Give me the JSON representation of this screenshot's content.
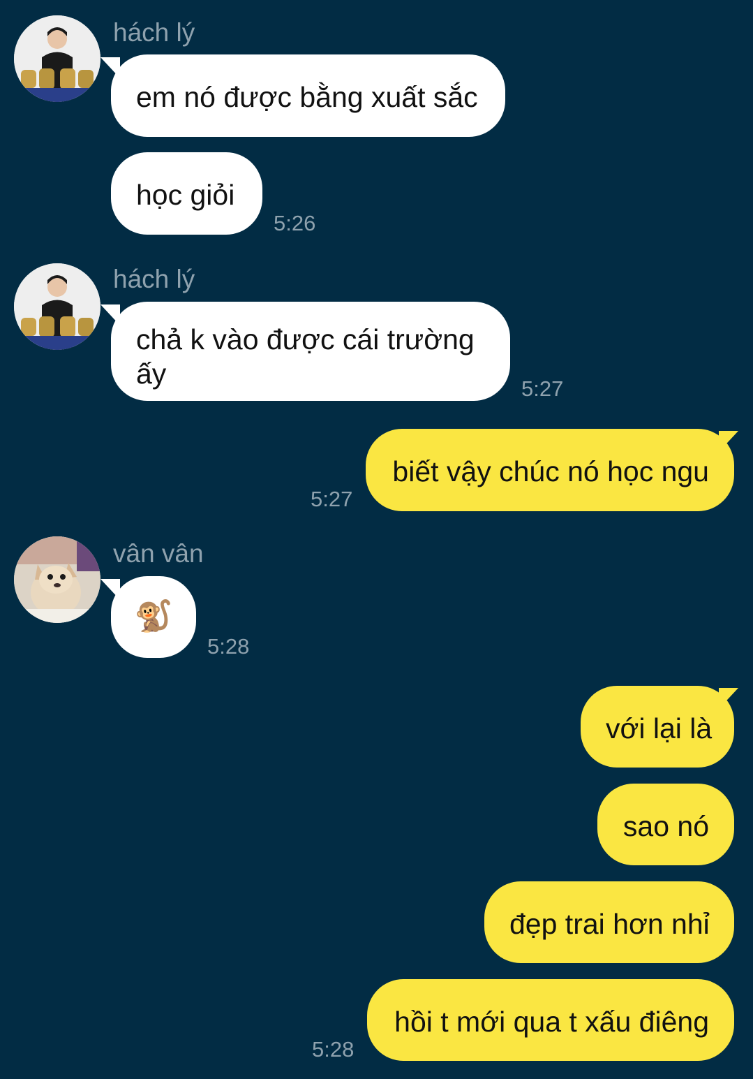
{
  "messages": [
    {
      "sender": "hách lý",
      "text": "em nó được bằng xuất sắc"
    },
    {
      "text": "học giỏi",
      "time": "5:26"
    },
    {
      "sender": "hách lý",
      "text": "chả k vào được cái trường ấy",
      "time": "5:27"
    },
    {
      "text": "biết vậy chúc nó học ngu",
      "time": "5:27"
    },
    {
      "sender": "vân vân",
      "text": "🐒",
      "time": "5:28"
    },
    {
      "text": "với lại là"
    },
    {
      "text": "sao nó"
    },
    {
      "text": "đẹp trai hơn nhỉ"
    },
    {
      "text": "hồi t mới qua t xấu điêng",
      "time": "5:28"
    }
  ],
  "colors": {
    "background": "#022C44",
    "incoming_bubble": "#FFFFFF",
    "outgoing_bubble": "#FAE642",
    "meta_text": "#8FA2AE"
  },
  "avatars": {
    "hach_ly": "person-with-trophies-avatar",
    "van_van": "dog-avatar"
  }
}
